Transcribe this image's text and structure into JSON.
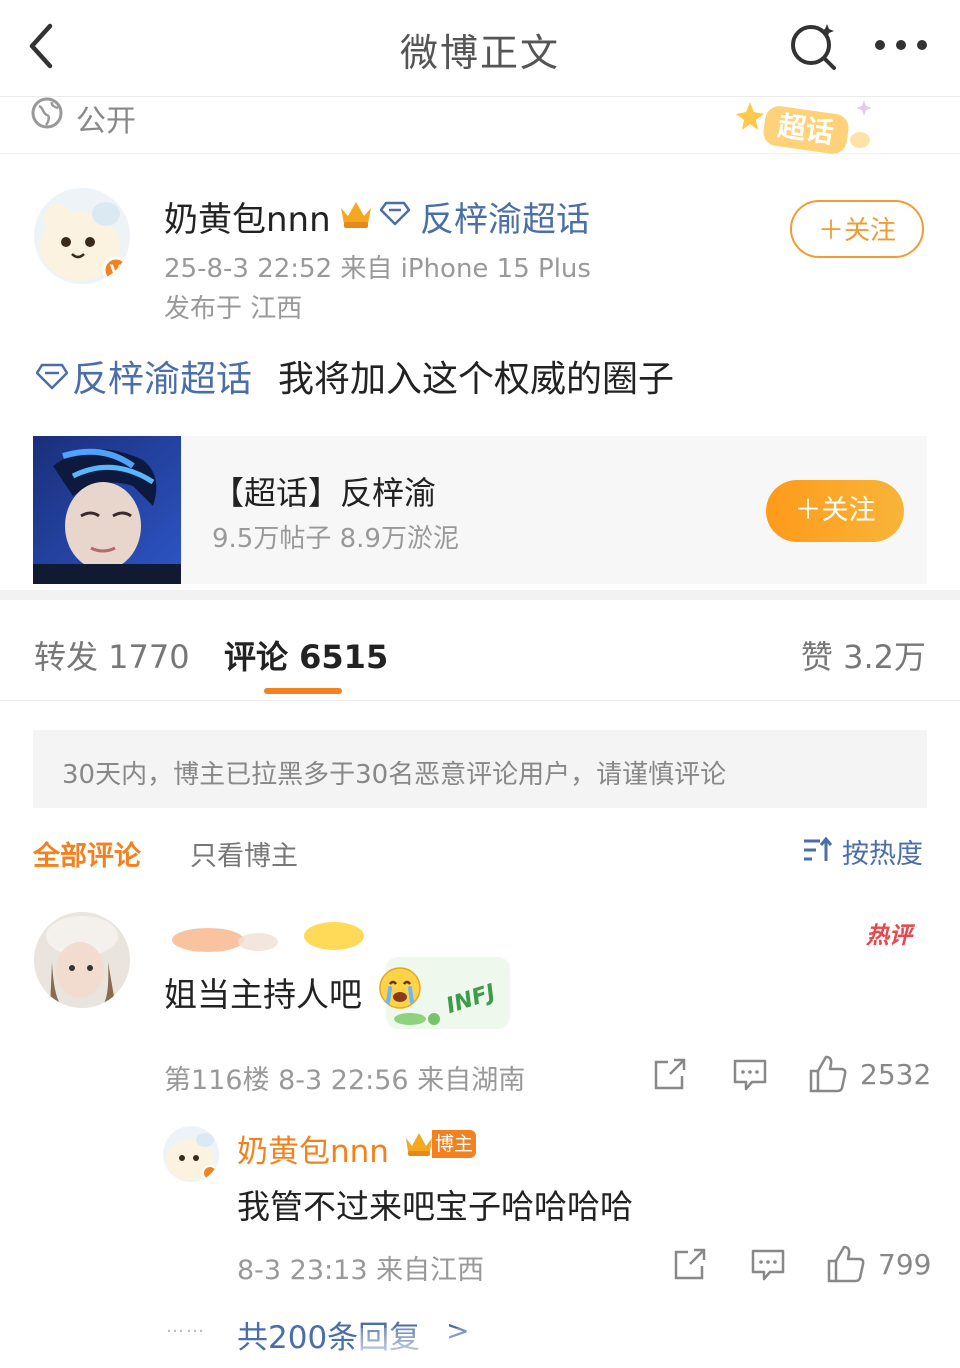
{
  "header": {
    "title": "微博正文"
  },
  "visibility": {
    "label": "公开"
  },
  "chaohua_badge": {
    "label": "超话"
  },
  "author": {
    "name": "奶黄包nnn",
    "topic": "反梓渝超话",
    "meta": "25-8-3 22:52  来自 iPhone 15 Plus",
    "location": "发布于 江西",
    "follow_label": "＋关注"
  },
  "post": {
    "topic": "反梓渝超话",
    "text": "我将加入这个权威的圈子"
  },
  "topic_card": {
    "title": "【超话】反梓渝",
    "stats": "9.5万帖子 8.9万淤泥",
    "follow_label": "＋关注"
  },
  "tabs": {
    "repost": "转发 1770",
    "comments": "评论 6515",
    "likes": "赞 3.2万"
  },
  "notice": "30天内，博主已拉黑多于30名恶意评论用户，请谨慎评论",
  "filters": {
    "all": "全部评论",
    "author_only": "只看博主",
    "sort": "按热度"
  },
  "comment": {
    "hot_label": "热评",
    "text": "姐当主持人吧",
    "sticker_text": "INFJ",
    "meta": "第116楼 8-3 22:56 来自湖南",
    "likes": "2532"
  },
  "reply": {
    "name": "奶黄包nnn",
    "badge": "博主",
    "text": "我管不过来吧宝子哈哈哈哈",
    "meta": "8-3 23:13 来自江西",
    "likes": "799"
  },
  "more_replies": {
    "dots": "……",
    "label": "共200条回复",
    "chevron": ">"
  },
  "colors": {
    "accent": "#f4811f",
    "link": "#4a6ea7",
    "hot": "#e8464b"
  }
}
